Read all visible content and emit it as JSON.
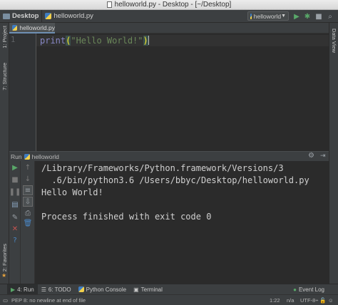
{
  "window": {
    "title": "helloworld.py - Desktop - [~/Desktop]"
  },
  "navbar": {
    "project": "Desktop",
    "file": "helloworld.py",
    "run_config": "helloworld"
  },
  "left_tabs": {
    "project": "1: Project",
    "structure": "7: Structure",
    "favorites": "2: Favorites"
  },
  "right_tabs": {
    "data_view": "Data View"
  },
  "editor": {
    "tab_label": "helloworld.py",
    "line_number": "1",
    "code": {
      "func": "print",
      "open": "(",
      "string": "\"Hello World!\"",
      "close": ")"
    }
  },
  "run_panel": {
    "label": "Run",
    "config": "helloworld",
    "output": "/Library/Frameworks/Python.framework/Versions/3\n  .6/bin/python3.6 /Users/bbyc/Desktop/helloworld.py\nHello World!\n\nProcess finished with exit code 0"
  },
  "tool_tabs": {
    "run": "4: Run",
    "todo": "6: TODO",
    "python_console": "Python Console",
    "terminal": "Terminal",
    "event_log": "Event Log"
  },
  "status": {
    "message": "PEP 8: no newline at end of file",
    "position": "1:22",
    "line_sep": "n/a",
    "encoding": "UTF-8÷"
  },
  "colors": {
    "run_green": "#59a869",
    "stop_red": "#c75450",
    "accent_blue": "#6e8fb3"
  }
}
